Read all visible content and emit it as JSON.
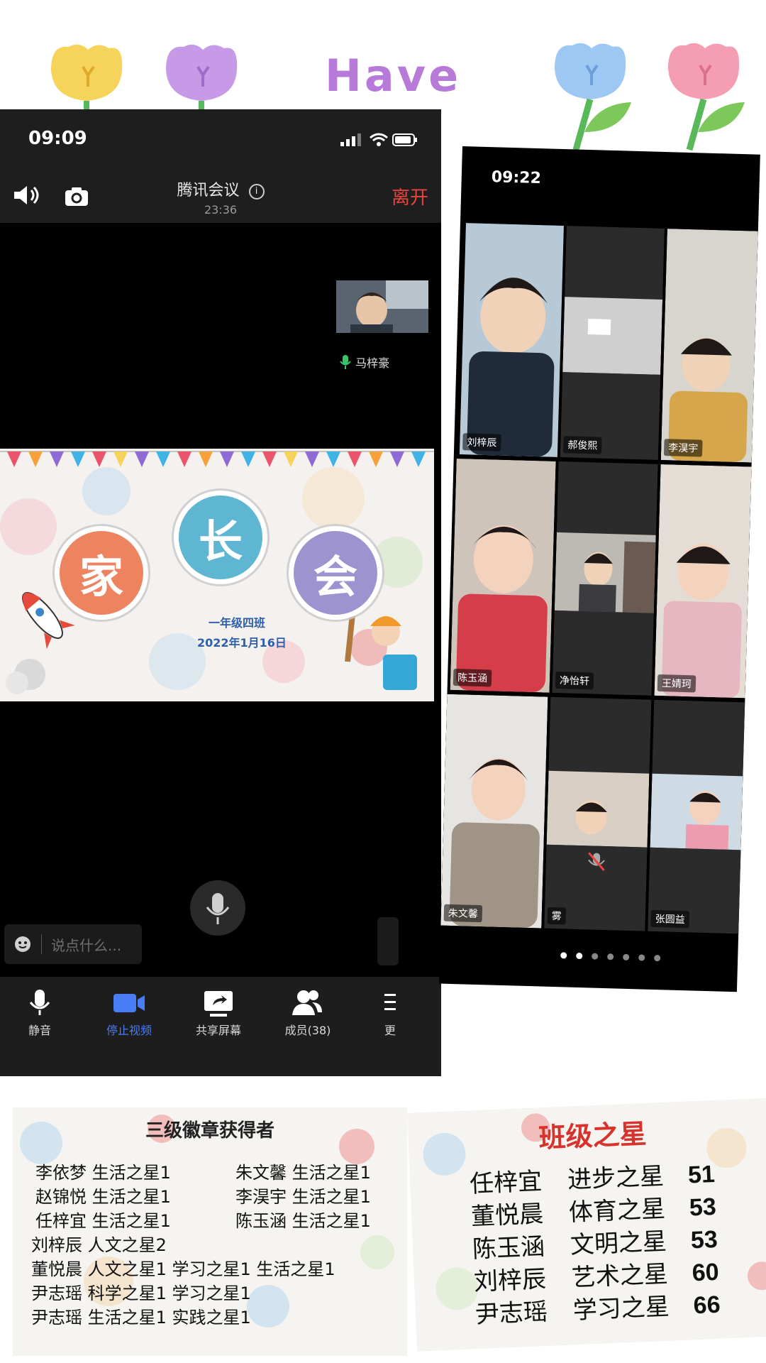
{
  "header_decoration": {
    "text": "Have"
  },
  "left_phone": {
    "status_time": "09:09",
    "meeting_title": "腾讯会议",
    "meeting_timer": "23:36",
    "leave_label": "离开",
    "self_view_name": "马梓豪",
    "shared_slide": {
      "characters": [
        "家",
        "长",
        "会"
      ],
      "class_name": "一年级四班",
      "date": "2022年1月16日"
    },
    "chat_placeholder": "说点什么...",
    "toolbar": [
      {
        "label": "静音",
        "icon": "mic-icon"
      },
      {
        "label": "停止视频",
        "icon": "video-camera-icon",
        "active": true
      },
      {
        "label": "共享屏幕",
        "icon": "share-screen-icon"
      },
      {
        "label": "成员(38)",
        "icon": "members-icon"
      },
      {
        "label": "更",
        "icon": "more-icon"
      }
    ],
    "accent_color": "#4a7cf6"
  },
  "right_phone": {
    "status_time": "09:22",
    "participants": [
      "刘梓辰",
      "郝俊熙",
      "李淏宇",
      "陈玉涵",
      "净怡轩",
      "王婧珂",
      "朱文馨",
      "雾",
      "张圆益"
    ],
    "page_dots": 7
  },
  "badge_slide": {
    "title": "三级徽章获得者",
    "rows": [
      "李依梦  生活之星1",
      "朱文馨  生活之星1",
      "赵锦悦  生活之星1",
      "李淏宇  生活之星1",
      "任梓宜  生活之星1",
      "陈玉涵  生活之星1",
      "刘梓辰  人文之星2",
      "董悦晨  人文之星1  学习之星1  生活之星1",
      "尹志瑶  科学之星1  学习之星1",
      "尹志瑶  生活之星1  实践之星1"
    ]
  },
  "stars_slide": {
    "title": "班级之星",
    "rows": [
      {
        "name": "任梓宜",
        "award": "进步之星",
        "score": "51"
      },
      {
        "name": "董悦晨",
        "award": "体育之星",
        "score": "53"
      },
      {
        "name": "陈玉涵",
        "award": "文明之星",
        "score": "53"
      },
      {
        "name": "刘梓辰",
        "award": "艺术之星",
        "score": "60"
      },
      {
        "name": "尹志瑶",
        "award": "学习之星",
        "score": "66"
      }
    ]
  }
}
